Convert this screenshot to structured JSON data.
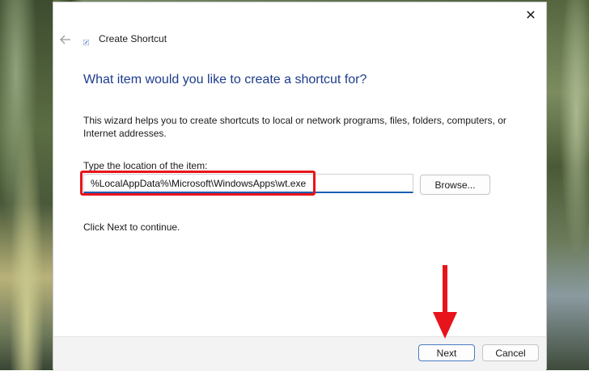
{
  "window": {
    "close_glyph": "✕"
  },
  "wizard": {
    "title": "Create Shortcut",
    "back_glyph": "←",
    "heading": "What item would you like to create a shortcut for?",
    "description": "This wizard helps you to create shortcuts to local or network programs, files, folders, computers, or Internet addresses.",
    "field_label": "Type the location of the item:",
    "location_value": "%LocalAppData%\\Microsoft\\WindowsApps\\wt.exe",
    "browse_label": "Browse...",
    "continue_text": "Click Next to continue."
  },
  "footer": {
    "next_label": "Next",
    "cancel_label": "Cancel"
  },
  "annotations": {
    "highlight_color": "#e8141b",
    "arrow_color": "#e8141b"
  },
  "colors": {
    "heading": "#1e3c8c",
    "input_focus": "#1a5fb4"
  }
}
